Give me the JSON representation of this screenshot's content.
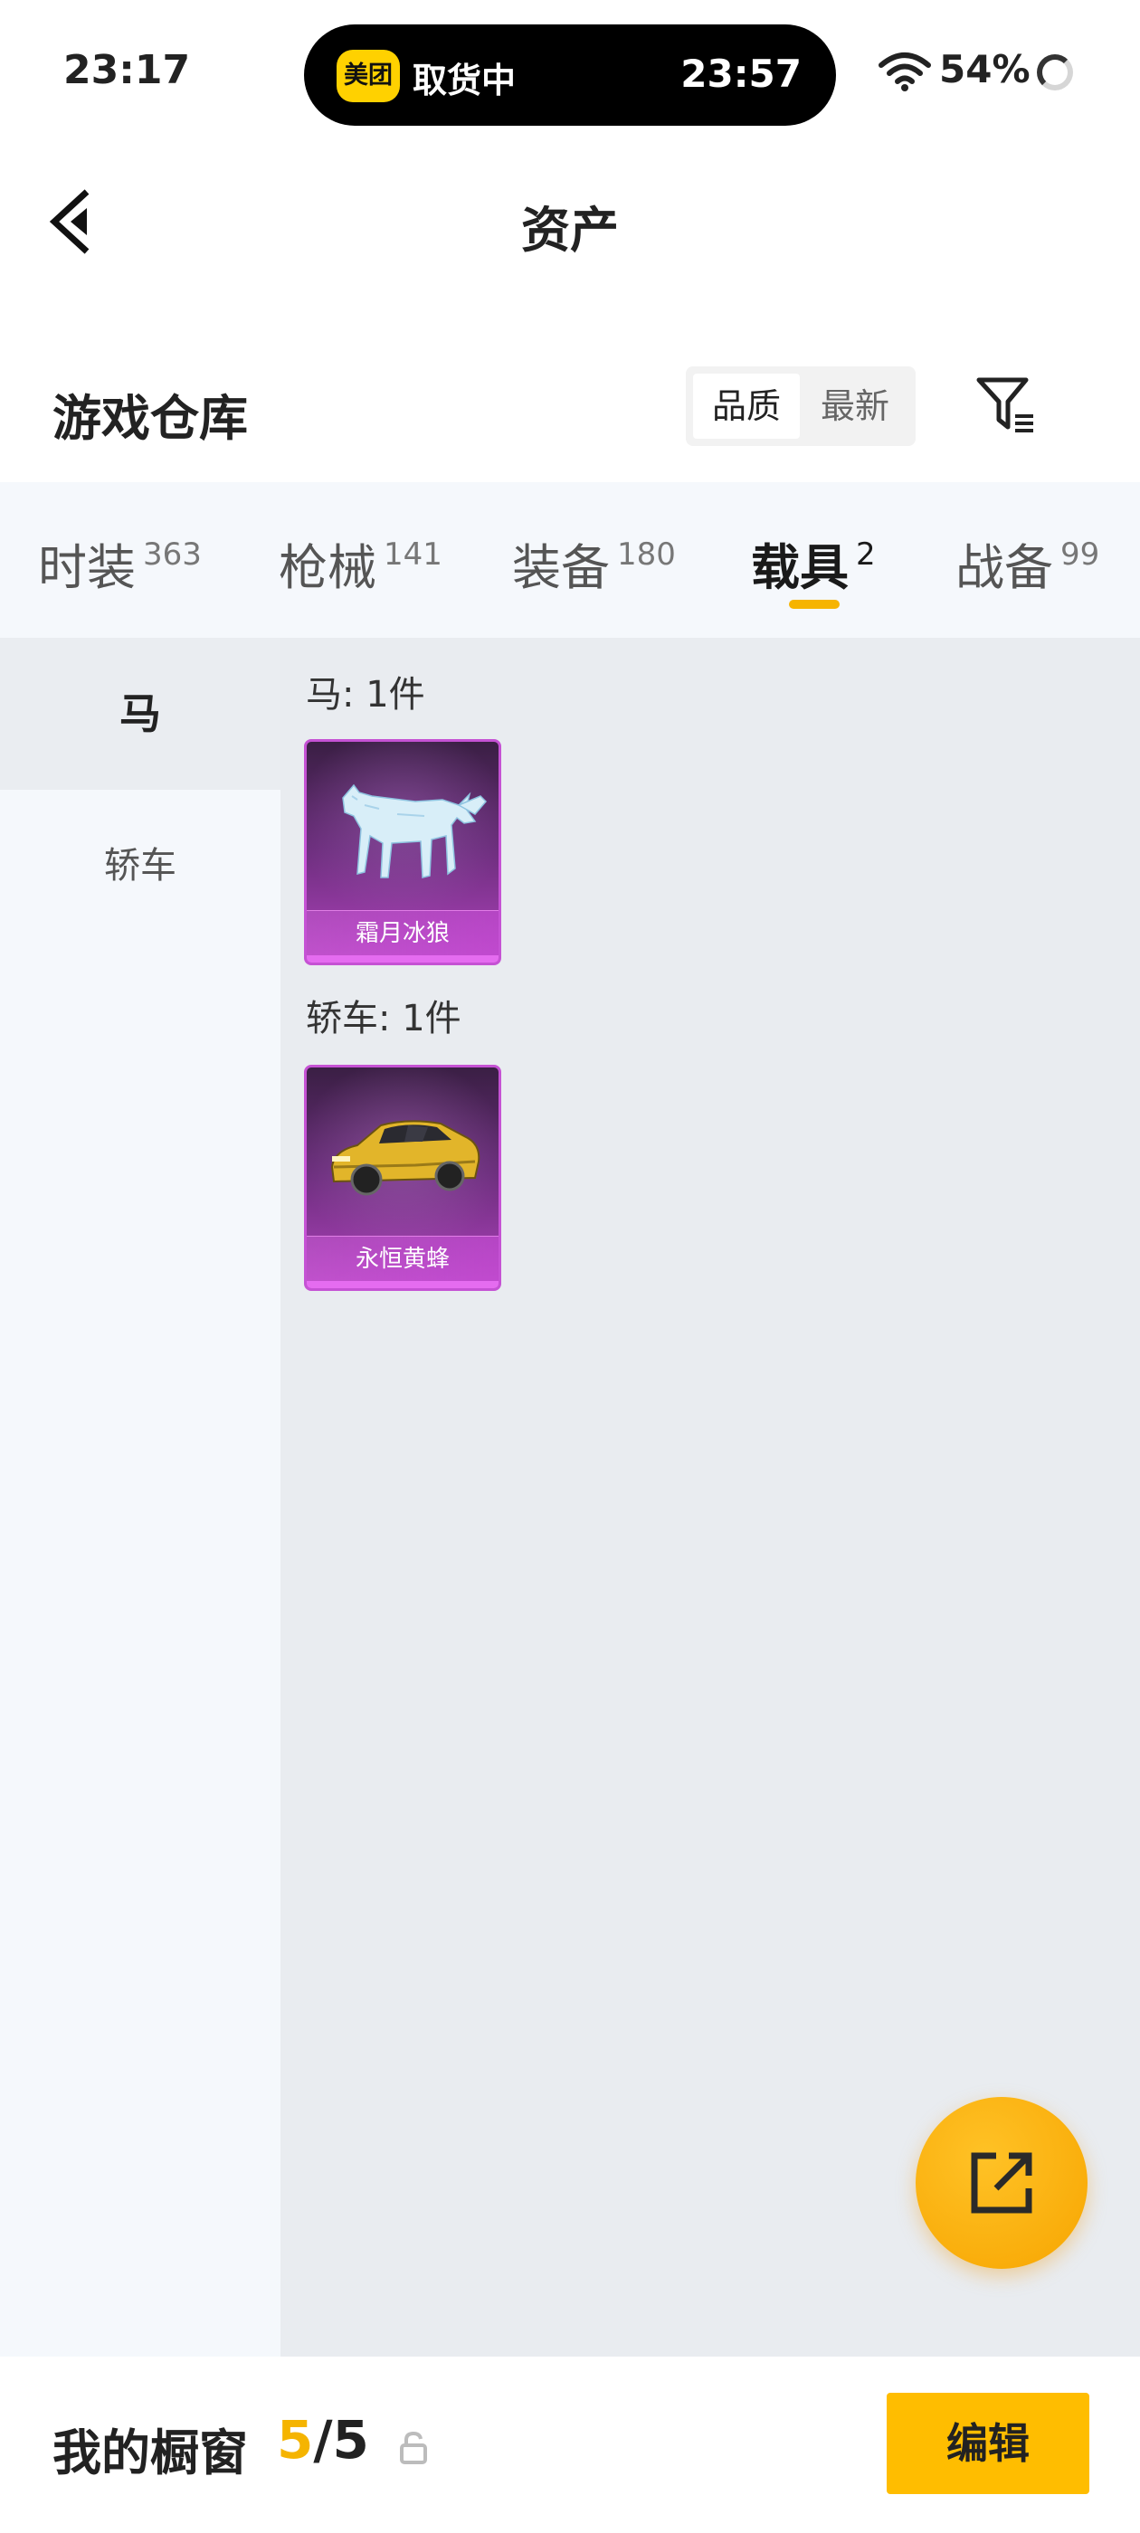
{
  "status_bar": {
    "time": "23:17",
    "island_logo": "美团",
    "island_text": "取货中",
    "island_time": "23:57",
    "battery": "54%"
  },
  "header": {
    "title": "资产"
  },
  "section": {
    "title": "游戏仓库",
    "sort_options": [
      "品质",
      "最新"
    ],
    "active_sort": "品质"
  },
  "tabs": [
    {
      "label": "时装",
      "count": "363",
      "active": false
    },
    {
      "label": "枪械",
      "count": "141",
      "active": false
    },
    {
      "label": "装备",
      "count": "180",
      "active": false
    },
    {
      "label": "载具",
      "count": "2",
      "active": true
    },
    {
      "label": "战备",
      "count": "99",
      "active": false
    }
  ],
  "sidebar": {
    "items": [
      {
        "label": "马",
        "active": true
      },
      {
        "label": "轿车",
        "active": false
      }
    ]
  },
  "groups": [
    {
      "label": "马: 1件",
      "items": [
        {
          "name": "霜月冰狼",
          "rarity_color": "#b043bd"
        }
      ]
    },
    {
      "label": "轿车: 1件",
      "items": [
        {
          "name": "永恒黄蜂",
          "rarity_color": "#b043bd"
        }
      ]
    }
  ],
  "fab": {
    "icon": "external-link-icon"
  },
  "bottom_bar": {
    "title": "我的橱窗",
    "count": "5",
    "slash": "/",
    "total": "5",
    "edit_label": "编辑"
  },
  "colors": {
    "accent": "#ffbd00",
    "tab_underline": "#f6b400",
    "rarity_purple": "#b043bd"
  }
}
